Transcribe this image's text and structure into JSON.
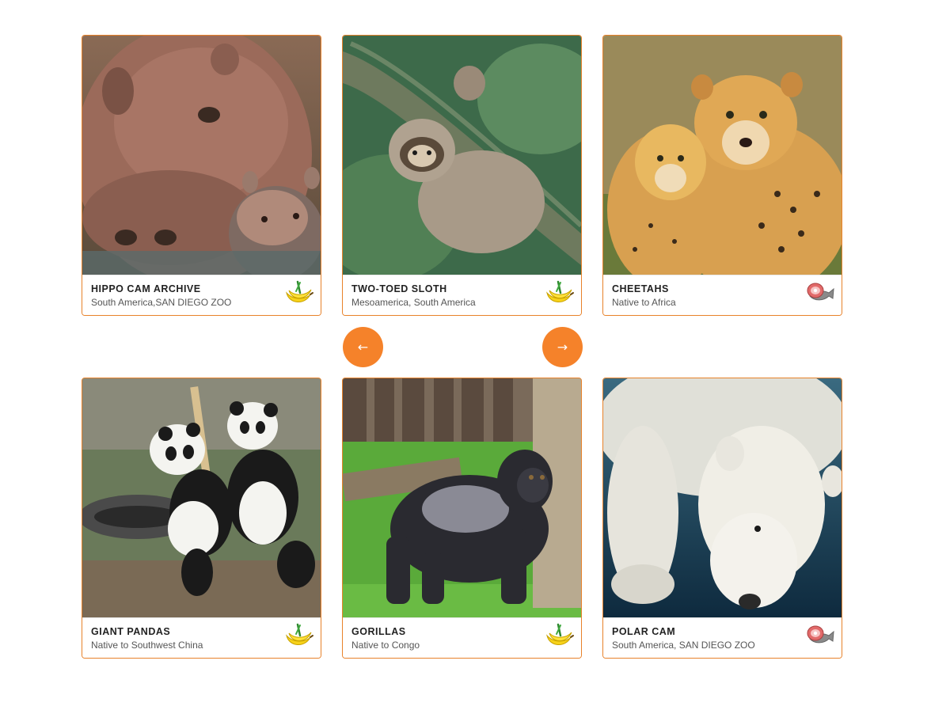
{
  "cards": [
    {
      "title": "HIPPO CAM ARCHIVE",
      "subtitle": "South America,SAN DIEGO ZOO",
      "diet": "herbivore",
      "diet_icon": "banana-icon",
      "photo": "hippo-photo"
    },
    {
      "title": "TWO-TOED SLOTH",
      "subtitle": "Mesoamerica, South America",
      "diet": "herbivore",
      "diet_icon": "banana-icon",
      "photo": "sloth-photo"
    },
    {
      "title": "CHEETAHS",
      "subtitle": "Native to Africa",
      "diet": "carnivore",
      "diet_icon": "meat-fish-icon",
      "photo": "cheetah-photo"
    },
    {
      "title": "GIANT PANDAS",
      "subtitle": "Native to Southwest China",
      "diet": "herbivore",
      "diet_icon": "banana-icon",
      "photo": "panda-photo"
    },
    {
      "title": "GORILLAS",
      "subtitle": "Native to Congo",
      "diet": "herbivore",
      "diet_icon": "banana-icon",
      "photo": "gorilla-photo"
    },
    {
      "title": "POLAR CAM",
      "subtitle": "South America, SAN DIEGO ZOO",
      "diet": "carnivore",
      "diet_icon": "meat-fish-icon",
      "photo": "polar-bear-photo"
    }
  ],
  "navigation": {
    "prev_label": "←",
    "next_label": "→",
    "prev_icon": "arrow-left-icon",
    "next_icon": "arrow-right-icon"
  },
  "colors": {
    "accent": "#f5822a",
    "card_border": "#e8822a",
    "title_text": "#222222",
    "subtitle_text": "#555555"
  }
}
